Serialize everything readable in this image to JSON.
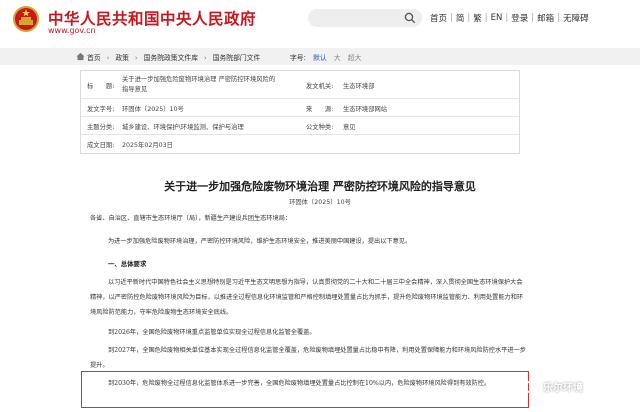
{
  "header": {
    "site_name": "中华人民共和国中央人民政府",
    "site_url": "www.gov.cn",
    "links": [
      "首页",
      "简",
      "繁",
      "EN",
      "登录",
      "邮箱",
      "无障碍"
    ],
    "brand_color": "#c8171e"
  },
  "breadcrumb": {
    "items": [
      "首页",
      "政策",
      "国务院政策文件库",
      "国务院部门文件"
    ],
    "font_size_label": "字号:",
    "font_default": "默认",
    "font_large": "大",
    "font_xlarge": "超大"
  },
  "meta": {
    "title_key": "标　　题:",
    "title_value": "关于进一步加强危险废物环境治理 严密防控环境风险的指导意见",
    "issuer_key": "发文机关:",
    "issuer_value": "生态环境部",
    "docno_key": "发文字号:",
    "docno_value": "环固体〔2025〕10号",
    "source_key": "来　　源:",
    "source_value": "生态环境部网站",
    "theme_key": "主题分类:",
    "theme_value": "城乡建设、环境保护\\环境监测、保护与治理",
    "type_key": "公文种类:",
    "type_value": "意见",
    "date_key": "成文日期:",
    "date_value": "2025年02月03日"
  },
  "document": {
    "title": "关于进一步加强危险废物环境治理 严密防控环境风险的指导意见",
    "number": "环固体〔2025〕10号",
    "salutation": "各省、自治区、直辖市生态环境厅（局），新疆生产建设兵团生态环境局：",
    "intro": "为进一步加强危险废物环境治理，严密防控环境风险，维护生态环境安全，推进美丽中国建设，提出以下意见。",
    "section1": "一、总体要求",
    "p1": "以习近平新时代中国特色社会主义思想特别是习近平生态文明思想为指导，认真贯彻党的二十大和二十届三中全会精神，深入贯彻全国生态环境保护大会精神，以严密防控危险废物环境风险为目标，以推进全过程信息化环境监管和严格控制填埋处置量占比为抓手，提升危险废物环境监管能力、利用处置能力和环境风险防范能力，守牢危险废物生态环境安全底线。",
    "p2": "到2026年，全国危险废物环境重点监管单位实现全过程信息化监管全覆盖。",
    "p3": "到2027年，全国危险废物相关单位基本实现全过程信息化监管全覆盖，危险废物填埋处置量占比稳中有降，利用处置保障能力和环境风险防控水平进一步提升。",
    "p4": "到2030年，危险废物全过程信息化监管体系进一步完善，全国危险废物填埋处置量占比控制在10%以内，危险废物环境风险得到有效防控。"
  },
  "watermark": {
    "text": "乐尔环境"
  }
}
